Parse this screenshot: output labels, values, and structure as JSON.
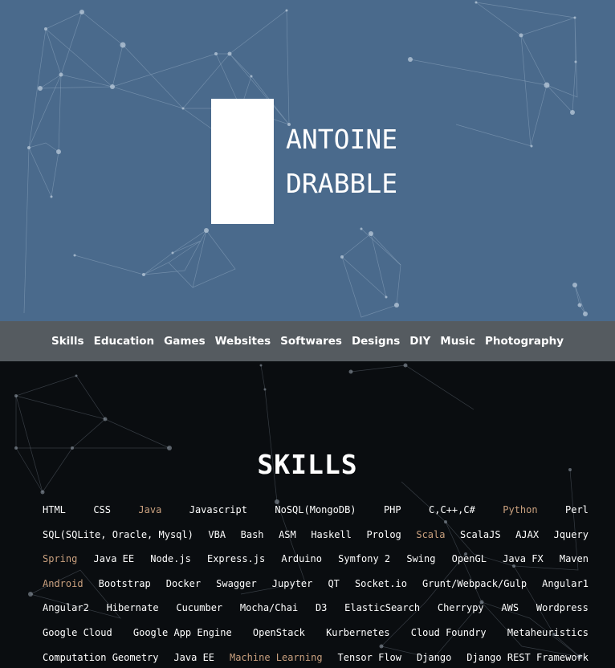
{
  "header": {
    "first_name": "ANTOINE",
    "last_name": "DRABBLE"
  },
  "nav": {
    "items": [
      "Skills",
      "Education",
      "Games",
      "Websites",
      "Softwares",
      "Designs",
      "DIY",
      "Music",
      "Photography"
    ]
  },
  "skills": {
    "title": "SKILLS",
    "rows": [
      [
        {
          "label": "HTML",
          "hl": false
        },
        {
          "label": "CSS",
          "hl": false
        },
        {
          "label": "Java",
          "hl": true
        },
        {
          "label": "Javascript",
          "hl": false
        },
        {
          "label": "NoSQL(MongoDB)",
          "hl": false
        },
        {
          "label": "PHP",
          "hl": false
        },
        {
          "label": "C,C++,C#",
          "hl": false
        },
        {
          "label": "Python",
          "hl": true
        },
        {
          "label": "Perl",
          "hl": false
        }
      ],
      [
        {
          "label": "SQL(SQLite, Oracle, Mysql)",
          "hl": false
        },
        {
          "label": "VBA",
          "hl": false
        },
        {
          "label": "Bash",
          "hl": false
        },
        {
          "label": "ASM",
          "hl": false
        },
        {
          "label": "Haskell",
          "hl": false
        },
        {
          "label": "Prolog",
          "hl": false
        },
        {
          "label": "Scala",
          "hl": true
        },
        {
          "label": "ScalaJS",
          "hl": false
        },
        {
          "label": "AJAX",
          "hl": false
        },
        {
          "label": "Jquery",
          "hl": false
        }
      ],
      [
        {
          "label": "Spring",
          "hl": true
        },
        {
          "label": "Java EE",
          "hl": false
        },
        {
          "label": "Node.js",
          "hl": false
        },
        {
          "label": "Express.js",
          "hl": false
        },
        {
          "label": "Arduino",
          "hl": false
        },
        {
          "label": "Symfony 2",
          "hl": false
        },
        {
          "label": "Swing",
          "hl": false
        },
        {
          "label": "OpenGL",
          "hl": false
        },
        {
          "label": "Java FX",
          "hl": false
        },
        {
          "label": "Maven",
          "hl": false
        }
      ],
      [
        {
          "label": "Android",
          "hl": true
        },
        {
          "label": "Bootstrap",
          "hl": false
        },
        {
          "label": "Docker",
          "hl": false
        },
        {
          "label": "Swagger",
          "hl": false
        },
        {
          "label": "Jupyter",
          "hl": false
        },
        {
          "label": "QT",
          "hl": false
        },
        {
          "label": "Socket.io",
          "hl": false
        },
        {
          "label": "Grunt/Webpack/Gulp",
          "hl": false
        },
        {
          "label": "Angular1",
          "hl": false
        }
      ],
      [
        {
          "label": "Angular2",
          "hl": false
        },
        {
          "label": "Hibernate",
          "hl": false
        },
        {
          "label": "Cucumber",
          "hl": false
        },
        {
          "label": "Mocha/Chai",
          "hl": false
        },
        {
          "label": "D3",
          "hl": false
        },
        {
          "label": "ElasticSearch",
          "hl": false
        },
        {
          "label": "Cherrypy",
          "hl": false
        },
        {
          "label": "AWS",
          "hl": false
        },
        {
          "label": "Wordpress",
          "hl": false
        }
      ],
      [
        {
          "label": "Google Cloud",
          "hl": false
        },
        {
          "label": "Google App Engine",
          "hl": false
        },
        {
          "label": "OpenStack",
          "hl": false
        },
        {
          "label": "Kurbernetes",
          "hl": false
        },
        {
          "label": "Cloud Foundry",
          "hl": false
        },
        {
          "label": "Metaheuristics",
          "hl": false
        }
      ],
      [
        {
          "label": "Computation Geometry",
          "hl": false
        },
        {
          "label": "Java EE",
          "hl": false
        },
        {
          "label": "Machine Learning",
          "hl": true
        },
        {
          "label": "Tensor Flow",
          "hl": false
        },
        {
          "label": "Django",
          "hl": false
        },
        {
          "label": "Django REST Framework",
          "hl": false
        }
      ]
    ]
  },
  "colors": {
    "hero_bg": "#4a6a8c",
    "navbar_bg": "#555b60",
    "dark_bg": "#0a0d10",
    "highlight": "#c9a07e"
  }
}
